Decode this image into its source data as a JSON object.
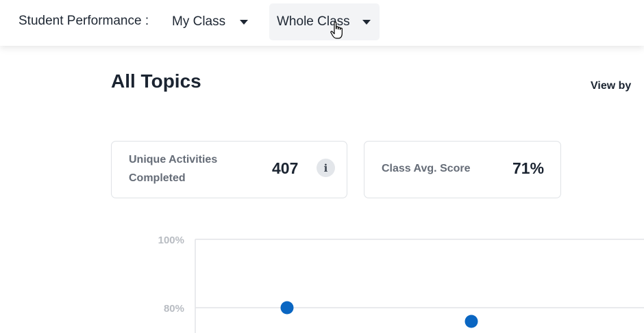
{
  "header": {
    "label": "Student Performance :",
    "class_select": {
      "selected": "My Class"
    },
    "group_select": {
      "selected": "Whole Class"
    }
  },
  "page": {
    "title": "All Topics",
    "view_by_label": "View by"
  },
  "cards": {
    "activities": {
      "label": "Unique Activities Completed",
      "value": "407",
      "info_icon": "info-icon"
    },
    "avg_score": {
      "label": "Class Avg. Score",
      "value": "71%"
    }
  },
  "colors": {
    "point": "#0a66c2",
    "grid": "#e2e4e7",
    "tick_text": "#b8bcc2"
  },
  "chart_data": {
    "type": "scatter",
    "yticks": [
      "100%",
      "80%"
    ],
    "ylim_visible": [
      80,
      100
    ],
    "series": [
      {
        "values": [
          80,
          76
        ]
      }
    ]
  }
}
